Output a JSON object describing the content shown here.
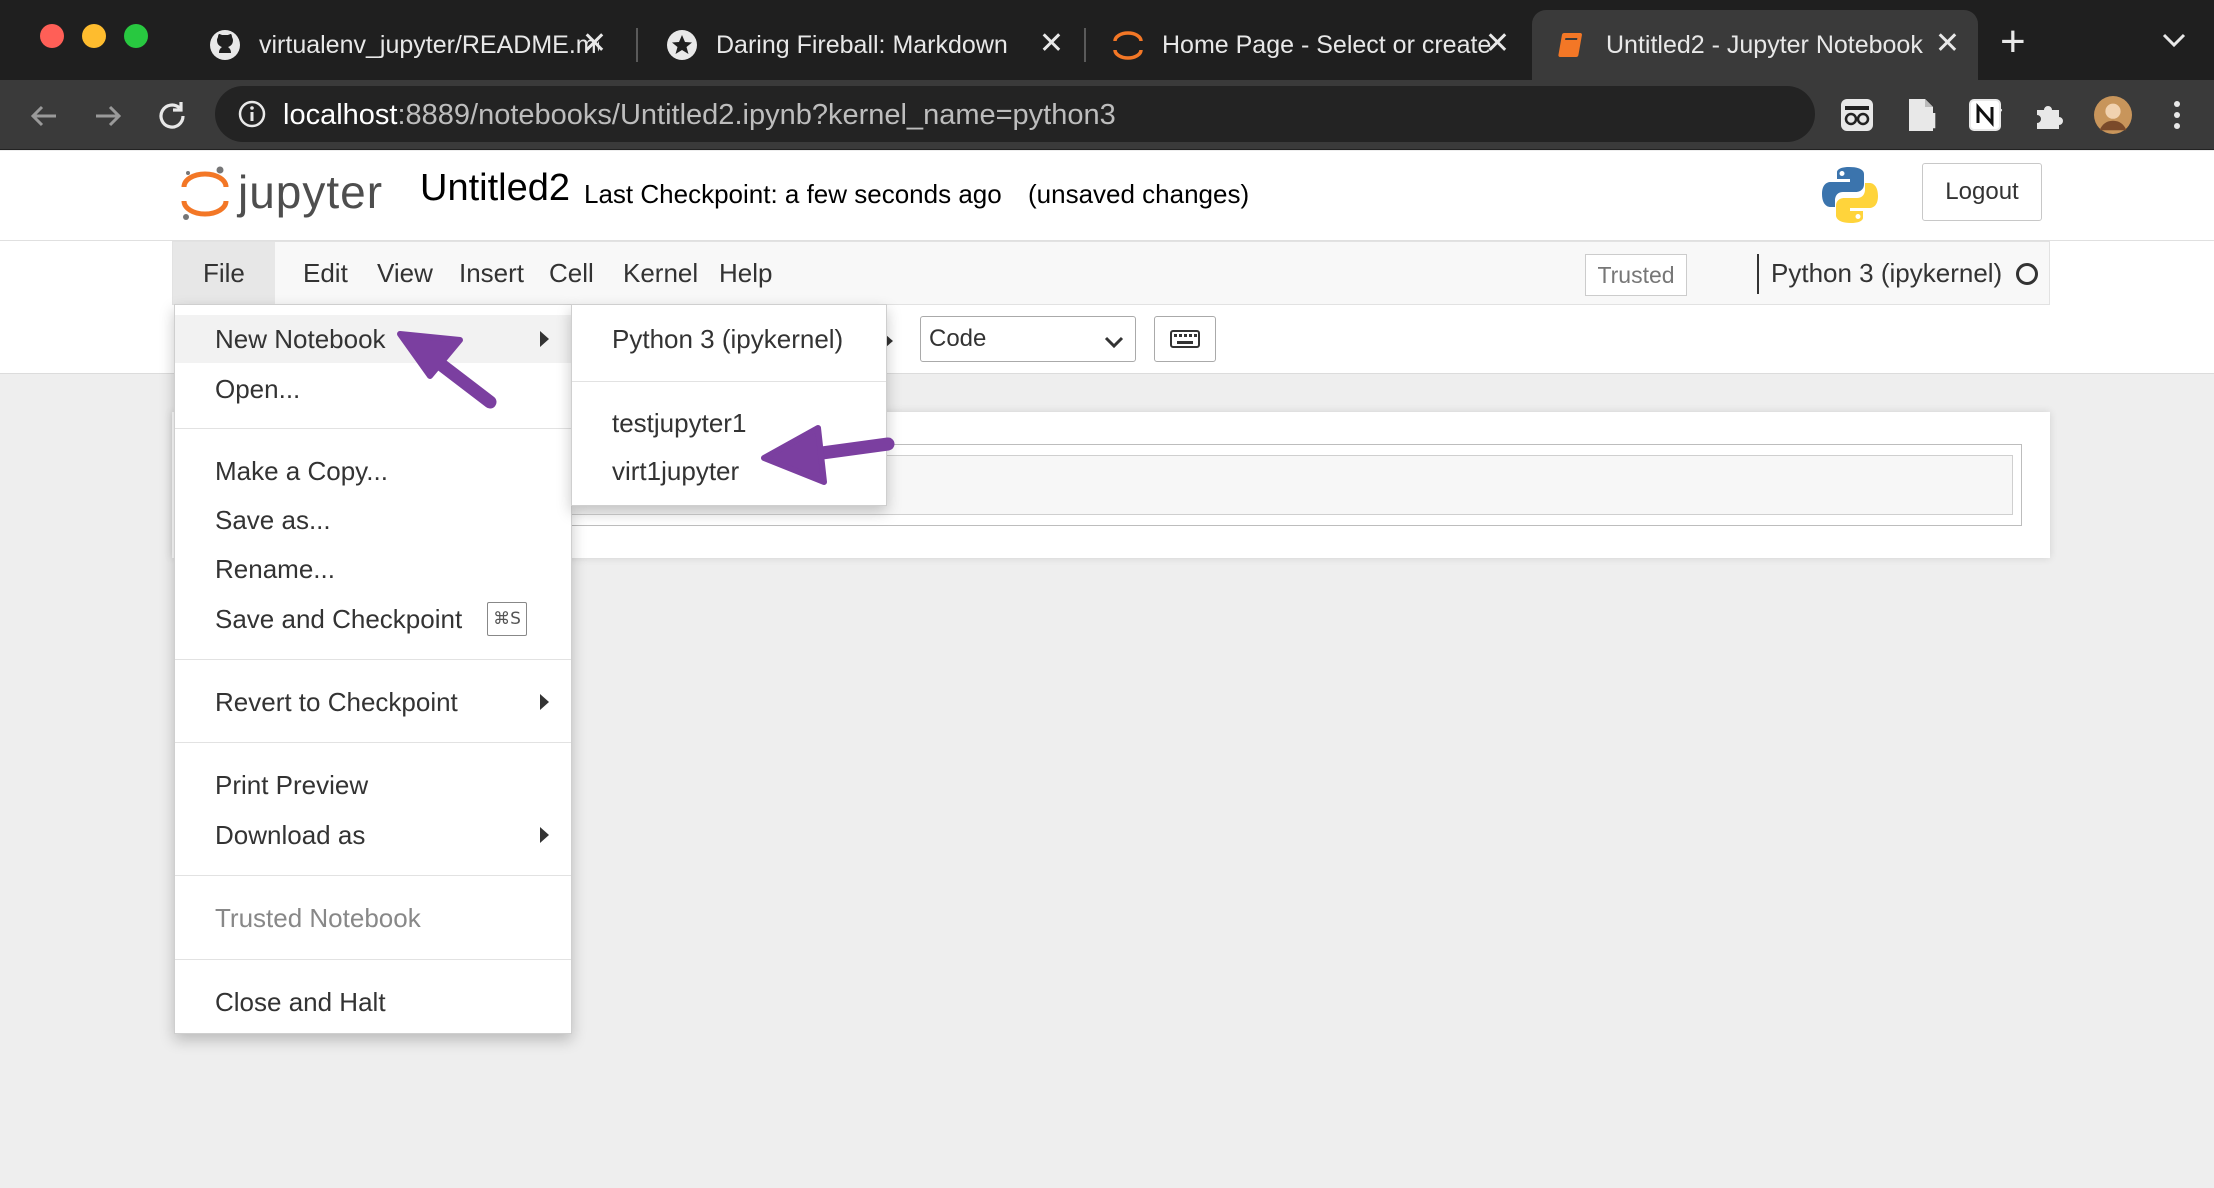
{
  "browser": {
    "tabs": [
      {
        "title": "virtualenv_jupyter/README.md",
        "icon": "github-icon",
        "active": false
      },
      {
        "title": "Daring Fireball: Markdown",
        "icon": "star-icon",
        "active": false
      },
      {
        "title": "Home Page - Select or create",
        "icon": "jupyter-icon",
        "active": false
      },
      {
        "title": "Untitled2 - Jupyter Notebook",
        "icon": "notebook-icon",
        "active": true
      }
    ],
    "new_tab_label": "+",
    "close_glyph": "✕",
    "url_host": "localhost",
    "url_rest": ":8889/notebooks/Untitled2.ipynb?kernel_name=python3"
  },
  "jupyter": {
    "logo_text": "jupyter",
    "notebook_name": "Untitled2",
    "checkpoint": "Last Checkpoint: a few seconds ago",
    "unsaved": "(unsaved changes)",
    "logout": "Logout",
    "menus": [
      "File",
      "Edit",
      "View",
      "Insert",
      "Cell",
      "Kernel",
      "Help"
    ],
    "trusted": "Trusted",
    "kernel": "Python 3 (ipykernel)",
    "cell_type": "Code"
  },
  "file_menu": {
    "items": [
      {
        "label": "New Notebook",
        "submenu": true
      },
      {
        "label": "Open..."
      },
      {
        "label": "Make a Copy..."
      },
      {
        "label": "Save as..."
      },
      {
        "label": "Rename..."
      },
      {
        "label": "Save and Checkpoint",
        "shortcut": "⌘S"
      },
      {
        "label": "Revert to Checkpoint",
        "submenu": true
      },
      {
        "label": "Print Preview"
      },
      {
        "label": "Download as",
        "submenu": true
      },
      {
        "label": "Trusted Notebook",
        "disabled": true
      },
      {
        "label": "Close and Halt"
      }
    ]
  },
  "new_notebook_submenu": {
    "items": [
      "Python 3 (ipykernel)",
      "testjupyter1",
      "virt1jupyter"
    ]
  },
  "colors": {
    "annotation_arrow": "#7b3fa0",
    "jupyter_orange": "#f37726",
    "tab_strip": "#1f1f1f"
  }
}
